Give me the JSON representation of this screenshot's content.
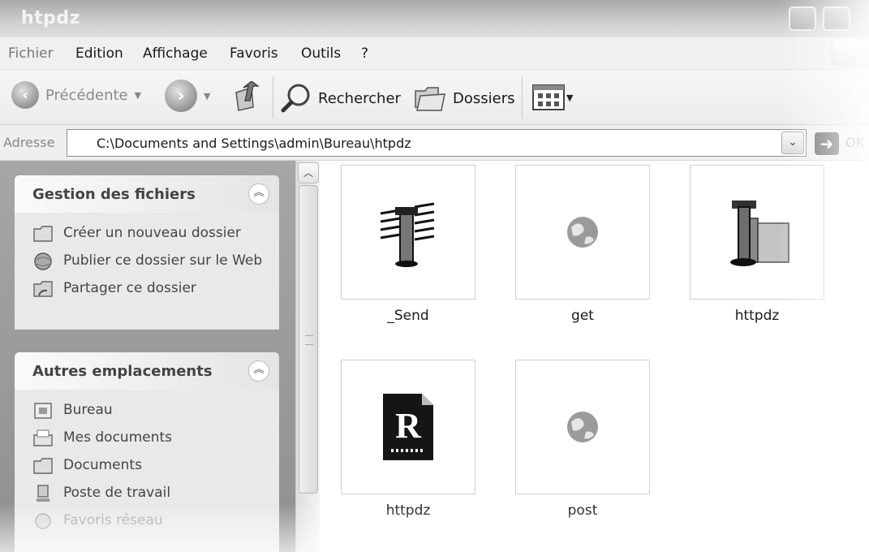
{
  "window": {
    "title": "htpdz"
  },
  "menu": {
    "items": [
      "Fichier",
      "Edition",
      "Affichage",
      "Favoris",
      "Outils",
      "?"
    ]
  },
  "toolbar": {
    "back_label": "Précédente",
    "search_label": "Rechercher",
    "folders_label": "Dossiers"
  },
  "address": {
    "label": "Adresse",
    "value": "C:\\Documents and Settings\\admin\\Bureau\\htpdz",
    "go_label": "OK"
  },
  "tasks_panel": {
    "title": "Gestion des fichiers",
    "items": [
      {
        "label": "Créer un nouveau dossier",
        "icon": "new-folder-icon"
      },
      {
        "label": "Publier ce dossier sur le Web",
        "icon": "publish-web-icon"
      },
      {
        "label": "Partager ce dossier",
        "icon": "share-folder-icon"
      }
    ]
  },
  "places_panel": {
    "title": "Autres emplacements",
    "items": [
      {
        "label": "Bureau",
        "icon": "desktop-icon"
      },
      {
        "label": "Mes documents",
        "icon": "my-documents-icon"
      },
      {
        "label": "Documents",
        "icon": "folder-icon"
      },
      {
        "label": "Poste de travail",
        "icon": "my-computer-icon"
      },
      {
        "label": "Favoris réseau",
        "icon": "network-places-icon"
      }
    ]
  },
  "files": [
    {
      "name": "_Send",
      "icon": "server-send-icon"
    },
    {
      "name": "get",
      "icon": "globe-icon"
    },
    {
      "name": "httpdz",
      "icon": "server-app-icon"
    },
    {
      "name": "httpdz",
      "icon": "resource-file-icon"
    },
    {
      "name": "post",
      "icon": "globe-icon"
    }
  ]
}
